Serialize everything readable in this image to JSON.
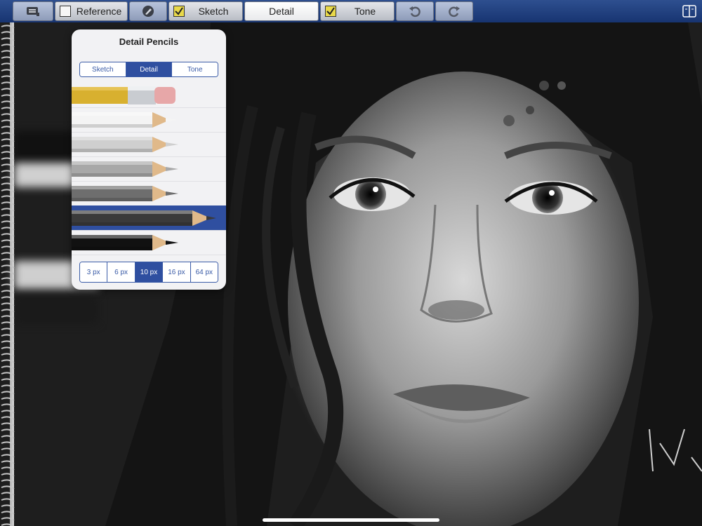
{
  "toolbar": {
    "menu_icon": "layers-menu-icon",
    "reference": {
      "label": "Reference",
      "checked": false
    },
    "brush_icon": "pencil-brush-icon",
    "sketch": {
      "label": "Sketch",
      "checked": true
    },
    "detail": {
      "label": "Detail"
    },
    "tone": {
      "label": "Tone",
      "checked": true
    },
    "undo_icon": "undo-icon",
    "redo_icon": "redo-icon",
    "panel_icon": "split-panel-icon"
  },
  "popover": {
    "title": "Detail Pencils",
    "tabs": [
      "Sketch",
      "Detail",
      "Tone"
    ],
    "selected_tab": "Detail",
    "pencils": [
      {
        "name": "eraser-pencil",
        "color": "#d8b02f"
      },
      {
        "name": "white-pencil",
        "color": "#f4f4f4"
      },
      {
        "name": "light-gray-pencil",
        "color": "#cfcfcf"
      },
      {
        "name": "gray-pencil",
        "color": "#a8a8a8"
      },
      {
        "name": "dark-gray-pencil",
        "color": "#6e6e6e"
      },
      {
        "name": "charcoal-pencil",
        "color": "#3a3a3a",
        "selected": true
      },
      {
        "name": "black-pencil",
        "color": "#111111"
      }
    ],
    "sizes": [
      "3 px",
      "6 px",
      "10 px",
      "16 px",
      "64 px"
    ],
    "selected_size": "10 px"
  },
  "colors": {
    "accent": "#2f4fa0",
    "toolbar": "#1f3b7a",
    "check": "#e9d94a"
  }
}
